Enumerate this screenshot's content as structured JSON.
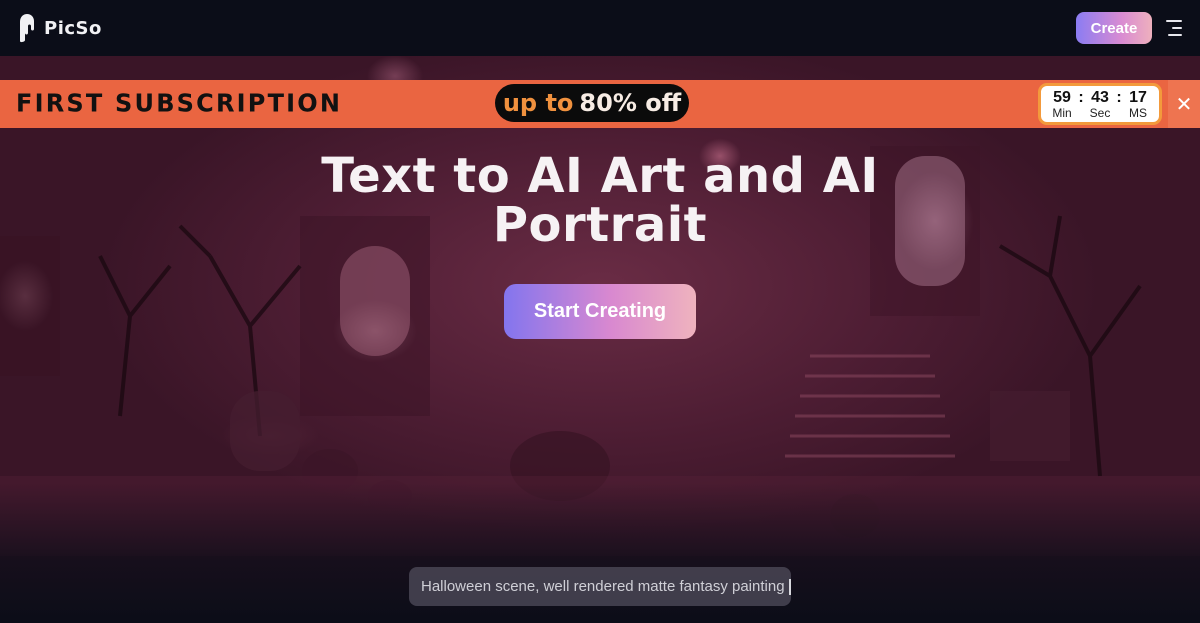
{
  "header": {
    "logo_icon": "picso-logo-icon",
    "logo_text": "PicSo",
    "create_label": "Create",
    "menu_icon": "hamburger-menu-icon"
  },
  "promo": {
    "title": "FIRST SUBSCRIPTION",
    "offer_prefix": "up to",
    "offer_value": "80% off",
    "countdown": {
      "minutes": "59",
      "seconds": "43",
      "ms": "17",
      "separator": ":",
      "min_label": "Min",
      "sec_label": "Sec",
      "ms_label": "MS"
    },
    "close_icon": "close-icon",
    "close_glyph": "✕",
    "colors": {
      "banner": "#ea6541",
      "accent": "#f0913e"
    }
  },
  "hero": {
    "title": "Text to AI Art and AI Portrait",
    "cta_label": "Start Creating",
    "prompt_text": "Halloween scene, well rendered matte fantasy painting",
    "background": "halloween-haunted-house-scene"
  },
  "colors": {
    "page_bg": "#0b0d18",
    "gradient_start": "#8375ee",
    "gradient_end": "#efb3be"
  }
}
